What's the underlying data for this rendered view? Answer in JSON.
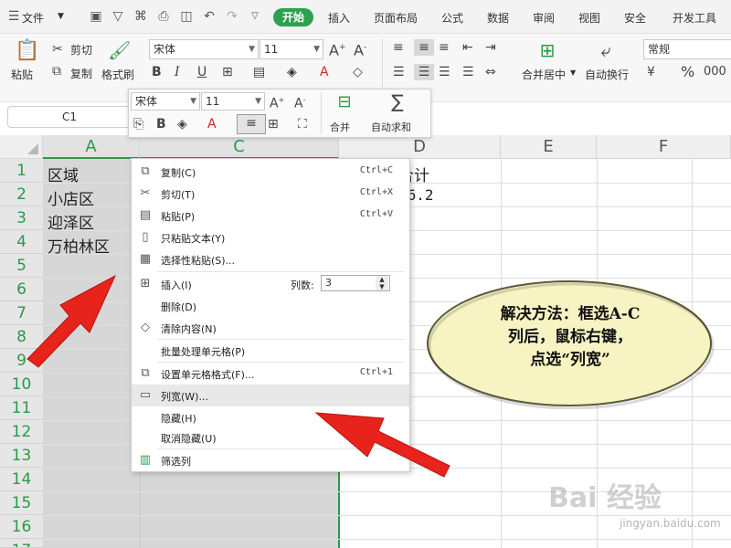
{
  "menubar": {
    "file_label": "文件",
    "tabs": [
      "开始",
      "插入",
      "页面布局",
      "公式",
      "数据",
      "审阅",
      "视图",
      "安全",
      "开发工具"
    ]
  },
  "ribbon": {
    "paste": "粘贴",
    "cut": "剪切",
    "copy": "复制",
    "format_painter": "格式刷",
    "font_name": "宋体",
    "font_size": "11",
    "merge_center": "合并居中",
    "wrap_text": "自动换行",
    "number_format": "常规"
  },
  "namebox": {
    "value": "C1"
  },
  "mini_toolbar": {
    "font_name": "宋体",
    "font_size": "11",
    "merge": "合并",
    "autosum": "自动求和"
  },
  "columns": [
    "A",
    "C",
    "D",
    "E",
    "F"
  ],
  "rows": [
    "1",
    "2",
    "3",
    "4",
    "5",
    "6",
    "7",
    "8",
    "9",
    "10",
    "11",
    "12",
    "13",
    "14",
    "15",
    "16",
    "17"
  ],
  "cells": {
    "a1": "区域",
    "a2": "小店区",
    "a3": "迎泽区",
    "a4": "万柏林区",
    "d1": "合计",
    "d2": "66.2"
  },
  "context_menu": {
    "items": [
      {
        "label": "复制(C)",
        "shortcut": "Ctrl+C",
        "icon": "copy-icon"
      },
      {
        "label": "剪切(T)",
        "shortcut": "Ctrl+X",
        "icon": "scissors-icon"
      },
      {
        "label": "粘贴(P)",
        "shortcut": "Ctrl+V",
        "icon": "paste-icon"
      },
      {
        "label": "只粘贴文本(Y)",
        "shortcut": "",
        "icon": "paste-text-icon"
      },
      {
        "label": "选择性粘贴(S)...",
        "shortcut": "",
        "icon": "paste-special-icon"
      },
      {
        "label": "插入(I)",
        "shortcut": "",
        "icon": "insert-icon"
      },
      {
        "label": "删除(D)",
        "shortcut": "",
        "icon": ""
      },
      {
        "label": "清除内容(N)",
        "shortcut": "",
        "icon": "eraser-icon"
      },
      {
        "label": "批量处理单元格(P)",
        "shortcut": "",
        "icon": ""
      },
      {
        "label": "设置单元格格式(F)...",
        "shortcut": "Ctrl+1",
        "icon": "format-cells-icon"
      },
      {
        "label": "列宽(W)...",
        "shortcut": "",
        "icon": "column-width-icon"
      },
      {
        "label": "隐藏(H)",
        "shortcut": "",
        "icon": ""
      },
      {
        "label": "取消隐藏(U)",
        "shortcut": "",
        "icon": ""
      },
      {
        "label": "筛选列",
        "shortcut": "",
        "icon": "filter-columns-icon"
      }
    ],
    "col_count_label": "列数:",
    "col_count_value": "3"
  },
  "callout": {
    "line1": "解决方法：框选A-C",
    "line2": "列后，鼠标右键，",
    "line3": "点选“列宽”"
  },
  "watermark": {
    "brand": "Bai 经验",
    "url": "jingyan.baidu.com"
  },
  "colors": {
    "accent_green": "#2ca24e",
    "arrow_red": "#e8231c",
    "callout_fill": "#f7f3c2"
  }
}
